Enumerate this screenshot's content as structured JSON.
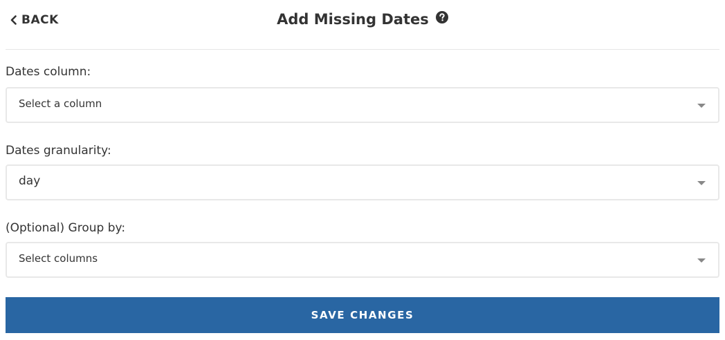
{
  "header": {
    "back_label": "BACK",
    "title": "Add Missing Dates"
  },
  "fields": [
    {
      "label": "Dates column:",
      "placeholder": "Select a column"
    },
    {
      "label": "Dates granularity:",
      "value": "day"
    },
    {
      "label": "(Optional) Group by:",
      "placeholder": "Select columns"
    }
  ],
  "save_label": "SAVE CHANGES",
  "colors": {
    "primary": "#2966a3",
    "text": "#333333",
    "border": "#e8e8e8",
    "divider": "#e6e6e6"
  },
  "icons": {
    "back": "chevron-left-icon",
    "help": "question-circle-icon",
    "dropdown": "caret-down-icon"
  }
}
